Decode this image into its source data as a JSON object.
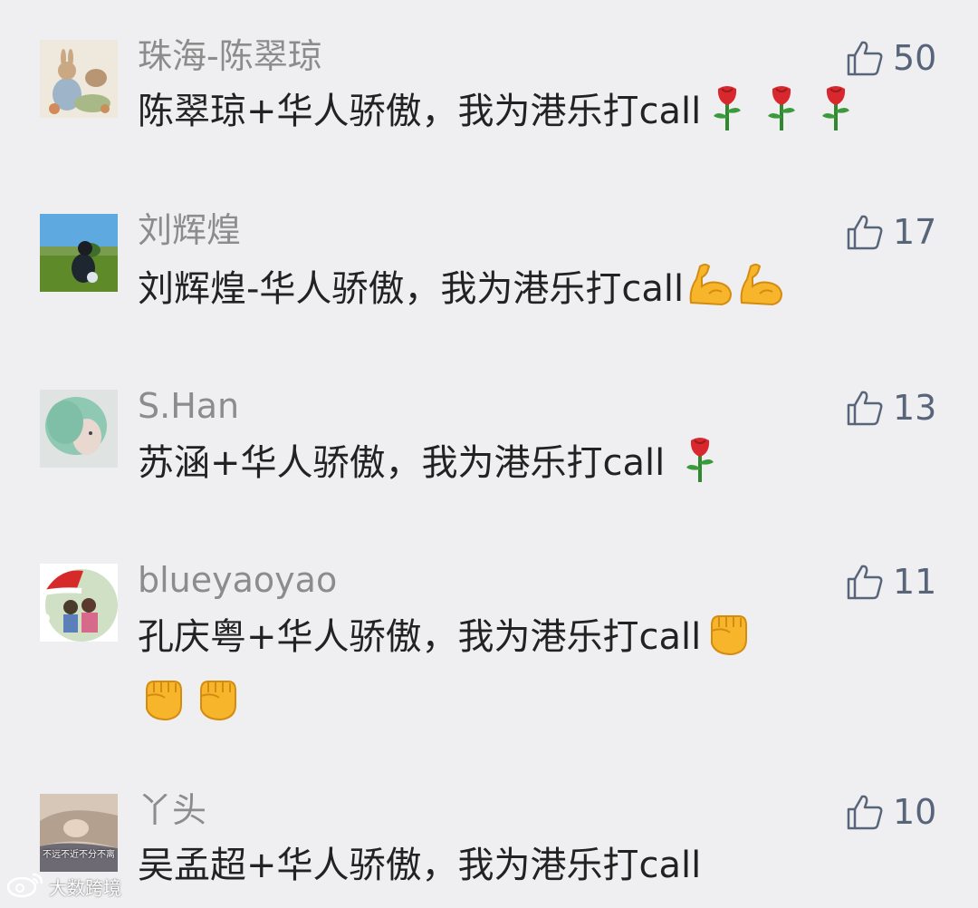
{
  "comments": [
    {
      "name": "珠海-陈翠琼",
      "text": "陈翠琼+华人骄傲，我为港乐打call",
      "likes": "50",
      "emoji": [
        "rose-emoji",
        "rose-emoji",
        "rose-emoji"
      ]
    },
    {
      "name": "刘辉煌",
      "text": "刘辉煌-华人骄傲，我为港乐打call",
      "likes": "17",
      "emoji": [
        "flexed-biceps-emoji",
        "flexed-biceps-emoji"
      ]
    },
    {
      "name": "S.Han",
      "text": "苏涵+华人骄傲，我为港乐打call",
      "likes": "13",
      "emoji": [
        "rose-emoji"
      ]
    },
    {
      "name": "blueyaoyao",
      "text": "孔庆粤+华人骄傲，我为港乐打call",
      "likes": "11",
      "emoji": [
        "raised-fist-emoji",
        "raised-fist-emoji",
        "raised-fist-emoji"
      ]
    },
    {
      "name": "丫头",
      "text": "吴孟超+华人骄傲，我为港乐打call",
      "likes": "10",
      "emoji": []
    }
  ],
  "watermark": {
    "text": "大数跨境",
    "icon": "weibo-logo-icon"
  },
  "avatar5_caption": "不远不近不分不离",
  "colors": {
    "background": "#efeff1",
    "name": "#8c8c8c",
    "text": "#222222",
    "like": "#57647a"
  },
  "like_icon": "thumbs-up-icon"
}
